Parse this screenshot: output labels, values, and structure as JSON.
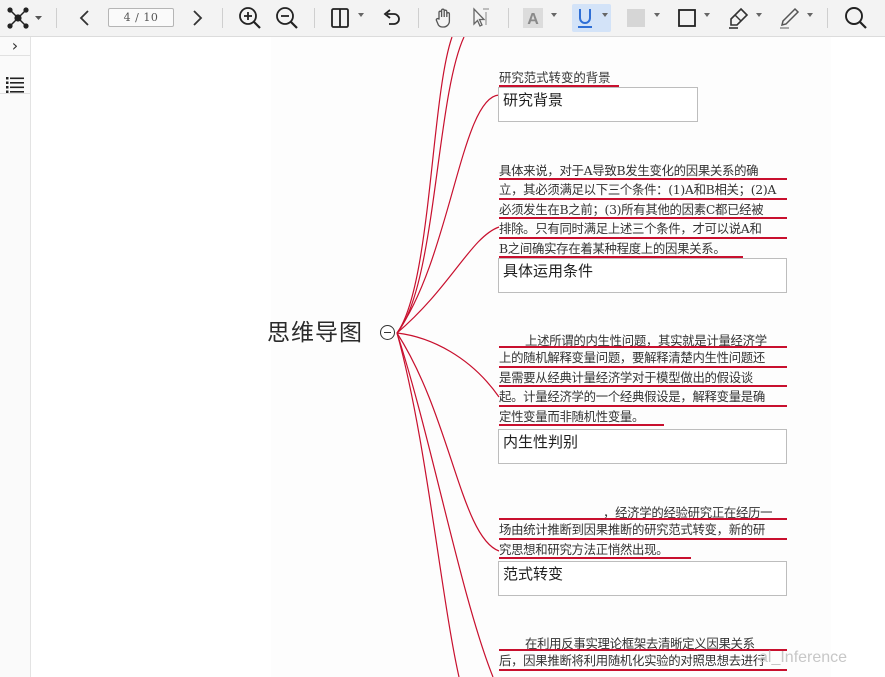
{
  "toolbar": {
    "page_indicator": "4 / 10",
    "tools": [
      {
        "name": "mindmap-menu-icon"
      },
      {
        "name": "prev-page-icon"
      },
      {
        "name": "next-page-icon"
      },
      {
        "name": "zoom-in-icon"
      },
      {
        "name": "zoom-out-icon"
      },
      {
        "name": "layout-toggle-icon"
      },
      {
        "name": "undo-icon"
      },
      {
        "name": "hand-tool-icon"
      },
      {
        "name": "select-tool-icon"
      },
      {
        "name": "text-highlight-icon"
      },
      {
        "name": "underline-icon",
        "active": true
      },
      {
        "name": "fill-color-icon"
      },
      {
        "name": "rectangle-icon"
      },
      {
        "name": "highlighter-icon"
      },
      {
        "name": "pen-icon"
      },
      {
        "name": "search-icon"
      }
    ],
    "text_tool_glyph": "A",
    "accent_color": "#2f6fd6",
    "active_bg": "#d3e3f8"
  },
  "rail": {
    "expand_glyph": "›"
  },
  "mindmap": {
    "root": "思维导图",
    "line_color": "#c8102e",
    "branches": [
      {
        "lines": [
          "研究范式转变的背景"
        ],
        "node": "研究背景"
      },
      {
        "lines": [
          "具体来说，对于A导致B发生变化的因果关系的确",
          "立，其必须满足以下三个条件：(1)A和B相关；(2)A",
          "必须发生在B之前；(3)所有其他的因素C都已经被",
          "排除。只有同时满足上述三个条件，才可以说A和",
          "B之间确实存在着某种程度上的因果关系。"
        ],
        "node": "具体运用条件"
      },
      {
        "lines": [
          "上述所谓的内生性问题，其实就是计量经济学",
          "上的随机解释变量问题，要解释清楚内生性问题还",
          "是需要从经典计量经济学对于模型做出的假设谈",
          "起。计量经济学的一个经典假设是，解释变量是确",
          "定性变量而非随机性变量。"
        ],
        "node": "内生性判别"
      },
      {
        "lines": [
          "，经济学的经验研究正在经历一",
          "场由统计推断到因果推断的研究范式转变，新的研",
          "究思想和研究方法正悄然出现。"
        ],
        "node": "范式转变"
      },
      {
        "lines": [
          "在利用反事实理论框架去清晰定义因果关系",
          "后，因果推断将利用随机化实验的对照思想去进行"
        ],
        "node": ""
      }
    ]
  },
  "watermark": "al_Inference"
}
